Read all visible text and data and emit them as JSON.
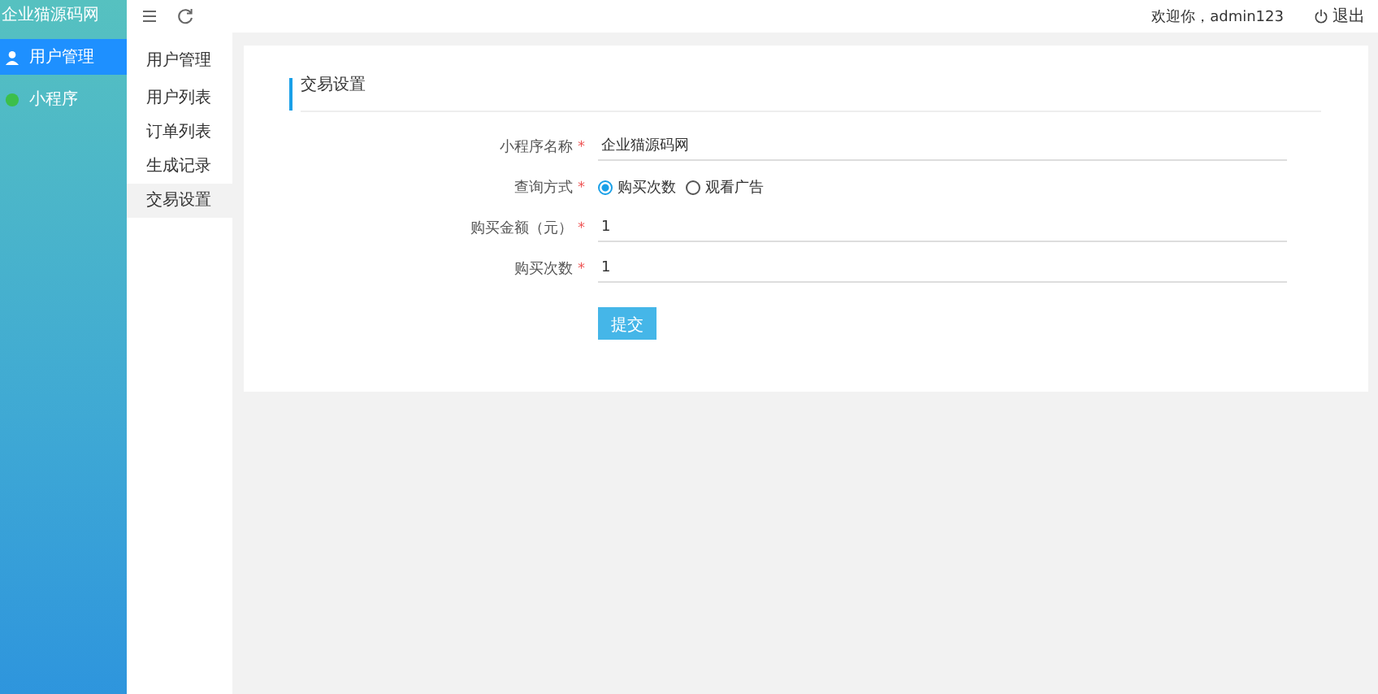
{
  "logo": "企业猫源码网",
  "sidebar": {
    "items": [
      {
        "label": "用户管理",
        "selected": true
      },
      {
        "label": "小程序",
        "selected": false
      }
    ]
  },
  "topbar": {
    "greeting": "欢迎你，admin123",
    "logout": "退出"
  },
  "subnav": {
    "title": "用户管理",
    "items": [
      {
        "label": "用户列表",
        "selected": false
      },
      {
        "label": "订单列表",
        "selected": false
      },
      {
        "label": "生成记录",
        "selected": false
      },
      {
        "label": "交易设置",
        "selected": true
      }
    ]
  },
  "card": {
    "title": "交易设置",
    "fields": [
      {
        "kind": "text",
        "label": "小程序名称",
        "mark": "*",
        "value": "企业猫源码网"
      },
      {
        "kind": "radio",
        "label": "查询方式",
        "mark": "*",
        "options": [
          {
            "label": "购买次数",
            "selected": true
          },
          {
            "label": "观看广告",
            "selected": false
          }
        ]
      },
      {
        "kind": "text",
        "label": "购买金额（元）",
        "mark": "*",
        "value": "1"
      },
      {
        "kind": "text",
        "label": "购买次数",
        "mark": "*",
        "value": "1"
      }
    ],
    "submit": "提交"
  }
}
